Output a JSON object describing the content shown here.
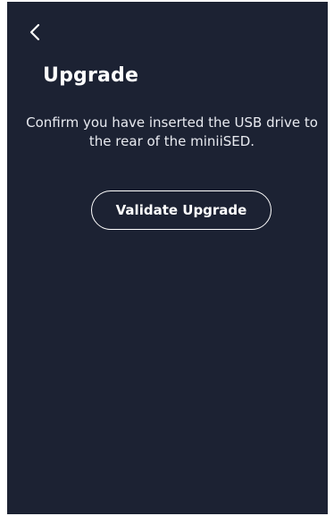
{
  "header": {
    "back_icon": "chevron-left-icon",
    "title": "Upgrade"
  },
  "main": {
    "instructions": "Confirm you have inserted the USB drive to the rear of the miniiSED.",
    "validate_button_label": "Validate Upgrade"
  },
  "colors": {
    "background": "#1c2233",
    "text": "#ffffff"
  }
}
